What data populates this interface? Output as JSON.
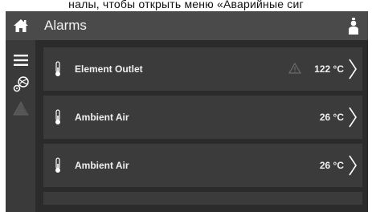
{
  "caption": "налы, чтобы открыть меню «Аварийные сиг",
  "header": {
    "title": "Alarms"
  },
  "sidebar": {
    "items": [
      "menu-icon",
      "fan-icon",
      "warning-icon"
    ]
  },
  "alarms": [
    {
      "name": "Element Outlet",
      "value": "122 °C",
      "warning": true
    },
    {
      "name": "Ambient Air",
      "value": "26 °C",
      "warning": false
    },
    {
      "name": "Ambient Air",
      "value": "26 °C",
      "warning": false
    }
  ],
  "colors": {
    "topbar": "#4a4a4a",
    "sidebar": "#3a3a3a",
    "background": "#2b2b2b",
    "row": "#3b3b3b",
    "text": "#f0f0f0"
  }
}
